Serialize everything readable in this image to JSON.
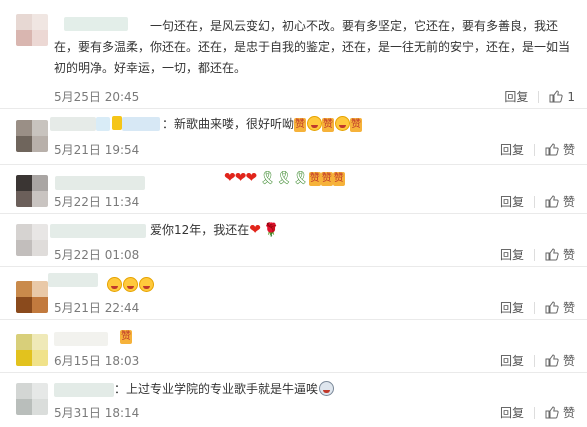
{
  "comments": [
    {
      "text": "一句还在，是风云变幻，初心不改。要有多坚定，它还在，要有多善良，我还在，要有多温柔，你还在。还在，是忠于自我的鉴定，还在，是一往无前的安宁，还在，是一如当初的明净。好幸运，一切，都还在。",
      "date": "5月25日 20:45",
      "reply_label": "回复",
      "like_label": "1"
    },
    {
      "text": "：新歌曲来喽，很好听呦",
      "date": "5月21日 19:54",
      "reply_label": "回复",
      "like_label": "赞"
    },
    {
      "text": "",
      "date": "5月22日 11:34",
      "reply_label": "回复",
      "like_label": "赞"
    },
    {
      "text": "爱你12年，我还在",
      "date": "5月22日 01:08",
      "reply_label": "回复",
      "like_label": "赞"
    },
    {
      "text": "",
      "date": "5月21日 22:44",
      "reply_label": "回复",
      "like_label": "赞"
    },
    {
      "text": "",
      "date": "6月15日 18:03",
      "reply_label": "回复",
      "like_label": "赞"
    },
    {
      "text": "：上过专业学院的专业歌手就是牛逼唉",
      "date": "5月31日 18:14",
      "reply_label": "回复",
      "like_label": "赞"
    }
  ],
  "icons": {
    "like": "thumbs-up-icon",
    "heart": "heart-icon",
    "ribbon": "green-ribbon-icon",
    "badge": "zan-badge-icon",
    "face": "emoji-face-icon",
    "rose": "rose-icon"
  },
  "badge_text": "赞",
  "colors": {
    "date": "#7a7a7a",
    "heart": "#e1251b",
    "ribbon": "#3c8a2e",
    "divider": "#eaeaea"
  }
}
